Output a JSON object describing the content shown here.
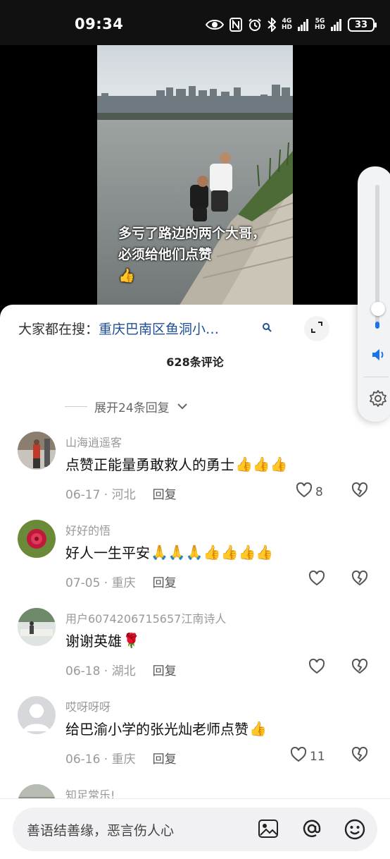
{
  "status_bar": {
    "time": "09:34",
    "net1_top": "4G",
    "net1_bottom": "HD",
    "net2_top": "5G",
    "net2_bottom": "HD",
    "battery": "33",
    "icons": [
      "eye-icon",
      "nfc-icon",
      "alarm-icon",
      "bluetooth-icon",
      "signal-icon",
      "battery-icon"
    ]
  },
  "video": {
    "caption": "多亏了路边的两个大哥，必须给他们点赞",
    "caption_emoji": "👍"
  },
  "volume": {
    "level": 0.05,
    "icons": [
      "speaker-icon",
      "settings-icon"
    ]
  },
  "search": {
    "label": "大家都在搜：",
    "query": "重庆巴南区鱼洞小…"
  },
  "comments_header": {
    "title": "628条评论",
    "expand_replies": "展开24条回复"
  },
  "comments": [
    {
      "author": "山海逍遥客",
      "text": "点赞正能量勇敢救人的勇士",
      "emoji": "👍👍👍",
      "date": "06-17",
      "location": "河北",
      "reply": "回复",
      "likes": "8"
    },
    {
      "author": "好好的悟",
      "text": "好人一生平安",
      "emoji": "🙏🙏🙏👍👍👍👍",
      "date": "07-05",
      "location": "重庆",
      "reply": "回复",
      "likes": ""
    },
    {
      "author": "用户6074206715657江南诗人",
      "text": "谢谢英雄",
      "emoji": "🌹",
      "date": "06-18",
      "location": "湖北",
      "reply": "回复",
      "likes": ""
    },
    {
      "author": "哎呀呀呀",
      "text": "给巴渝小学的张光灿老师点赞",
      "emoji": "👍",
      "date": "06-16",
      "location": "重庆",
      "reply": "回复",
      "likes": "11"
    },
    {
      "author": "知足常乐!",
      "text": "",
      "emoji": "",
      "date": "",
      "location": "",
      "reply": "",
      "likes": ""
    }
  ],
  "input": {
    "placeholder": "善语结善缘，恶言伤人心",
    "icons": [
      "image-icon",
      "at-icon",
      "emoji-icon"
    ]
  },
  "colors": {
    "link": "#1f4d96",
    "volume_accent": "#1a73e8",
    "muted_text": "#999999"
  }
}
